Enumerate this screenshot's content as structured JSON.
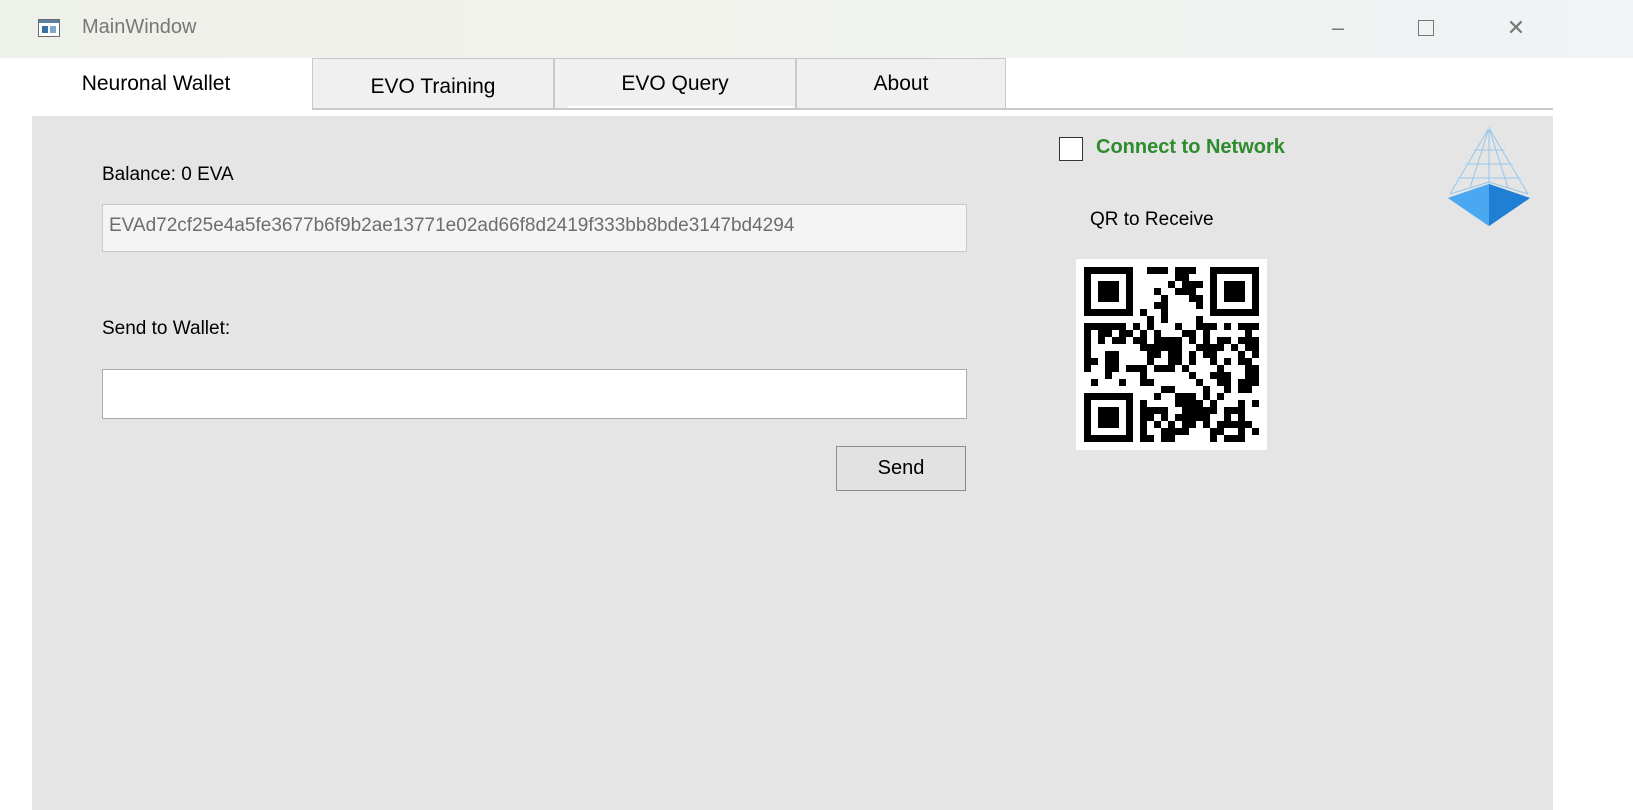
{
  "window": {
    "title": "MainWindow",
    "controls": {
      "minimize": "–",
      "close": "✕"
    }
  },
  "tabs": [
    {
      "label": "Neuronal Wallet",
      "selected": true
    },
    {
      "label": "EVO Training",
      "selected": false
    },
    {
      "label": "EVO Query",
      "selected": false
    },
    {
      "label": "About",
      "selected": false
    }
  ],
  "wallet": {
    "balance_label": "Balance: 0 EVA",
    "address": "EVAd72cf25e4a5fe3677b6f9b2ae13771e02ad66f8d2419f333bb8bde3147bd4294",
    "send_label": "Send to Wallet:",
    "send_value": "",
    "send_button": "Send"
  },
  "network": {
    "connect_label": "Connect to Network",
    "connected": false,
    "label_color": "#2e8b2e"
  },
  "qr": {
    "label": "QR to Receive"
  },
  "icons": {
    "app": "window-app-icon",
    "logo": "pyramid-logo-icon",
    "qr": "qr-code"
  }
}
